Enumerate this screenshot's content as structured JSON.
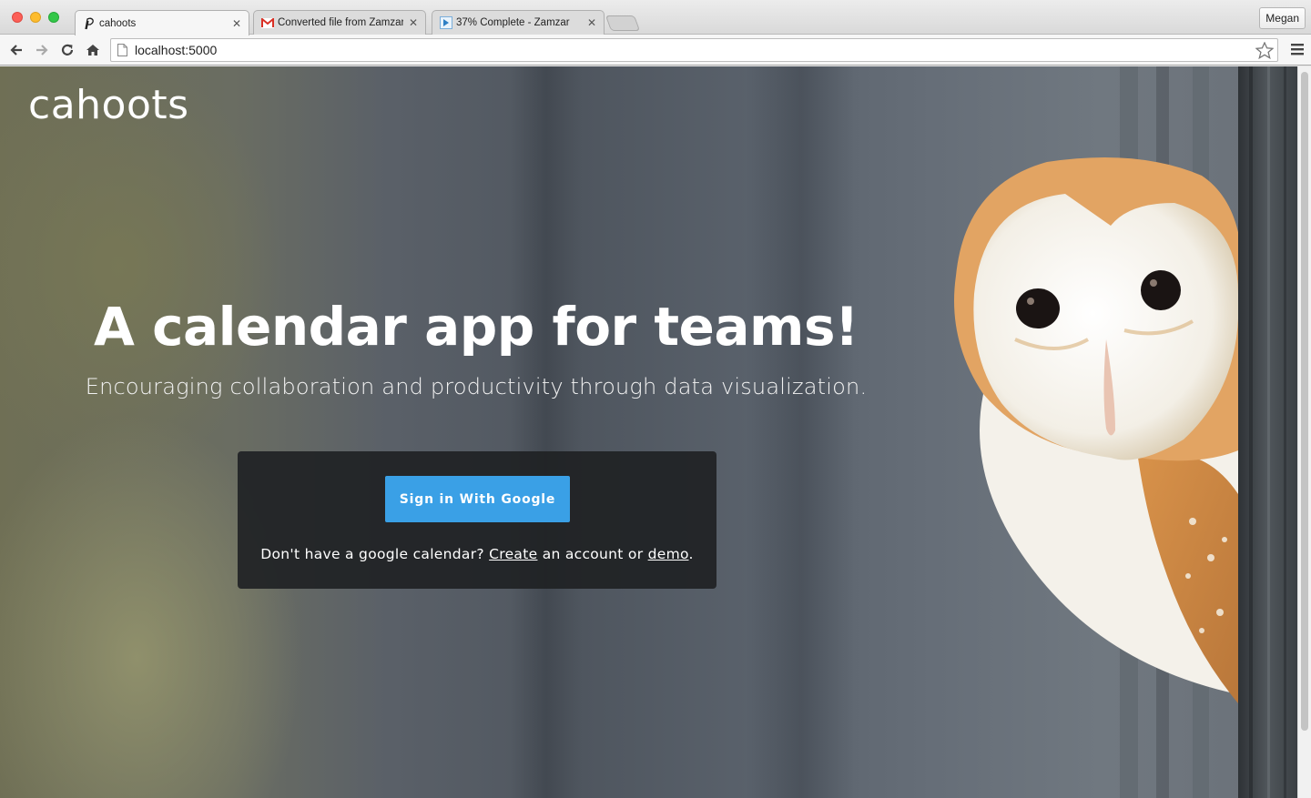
{
  "browser": {
    "tabs": [
      {
        "title": "cahoots",
        "icon": "cahoots-favicon",
        "active": true
      },
      {
        "title": "Converted file from Zamzar",
        "icon": "gmail-icon",
        "active": false
      },
      {
        "title": "37% Complete - Zamzar",
        "icon": "zamzar-icon",
        "active": false
      }
    ],
    "profile": "Megan",
    "url": "localhost:5000"
  },
  "page": {
    "logo": "cahoots",
    "headline": "A calendar app for teams!",
    "subheadline": "Encouraging collaboration and productivity through data visualization.",
    "signin": {
      "button_label": "Sign in With Google",
      "note_prefix": "Don't have a google calendar?",
      "create_link": "Create",
      "note_middle": "an account or",
      "demo_link": "demo",
      "note_suffix": "."
    }
  },
  "colors": {
    "button_blue": "#3aa0e6",
    "card_bg": "#202224"
  }
}
